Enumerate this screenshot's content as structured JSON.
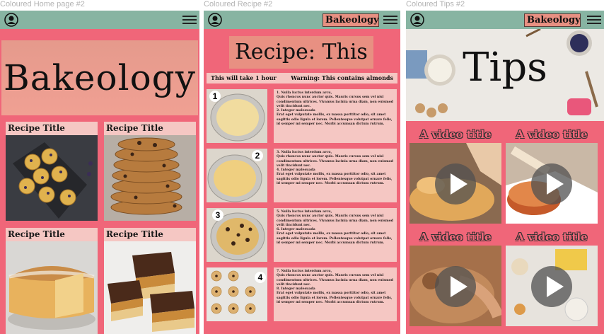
{
  "frames": {
    "home_label": "Coloured Home page #2",
    "recipe_label": "Coloured Recipe #2",
    "tips_label": "Coloured Tips #2"
  },
  "brand": "Bakeology",
  "home": {
    "hero_title": "Bakeology",
    "cards": [
      {
        "title": "Recipe Title",
        "image": "blueberry-muffins"
      },
      {
        "title": "Recipe Title",
        "image": "chocolate-chip-cookies"
      },
      {
        "title": "Recipe Title",
        "image": "sponge-cake"
      },
      {
        "title": "Recipe Title",
        "image": "caramel-shortbread"
      }
    ]
  },
  "recipe": {
    "title": "Recipe: This",
    "time": "This will take 1 hour",
    "warning": "Warning: This contains almonds",
    "steps": [
      {
        "num": "1",
        "a_title": "1. Nulla luctus interdum arcu,",
        "a_body": "Quis rhoncus nunc auctor quis. Mauris cursus sem vel nisl condimentum ultrices. Vivamus lacinia urna diam, non euismod velit tincidunt nec.",
        "b_title": "2. Integer malesuada",
        "b_body": "Erat eget vulputate mollis, ex massa porttitor odio, sit amet sagittis odio ligula et lorem. Pellentesque volutpat ornare felis, id semper mi semper nec. Morbi accumsan dictum rutrum."
      },
      {
        "num": "2",
        "a_title": "3. Nulla luctus interdum arcu,",
        "a_body": "Quis rhoncus nunc auctor quis. Mauris cursus sem vel nisl condimentum ultrices. Vivamus lacinia urna diam, non euismod velit tincidunt nec.",
        "b_title": "4. Integer malesuada",
        "b_body": "Erat eget vulputate mollis, ex massa porttitor odio, sit amet sagittis odio ligula et lorem. Pellentesque volutpat ornare felis, id semper mi semper nec. Morbi accumsan dictum rutrum."
      },
      {
        "num": "3",
        "a_title": "5. Nulla luctus interdum arcu,",
        "a_body": "Quis rhoncus nunc auctor quis. Mauris cursus sem vel nisl condimentum ultrices. Vivamus lacinia urna diam, non euismod velit tincidunt nec.",
        "b_title": "6. Integer malesuada",
        "b_body": "Erat eget vulputate mollis, ex massa porttitor odio, sit amet sagittis odio ligula et lorem. Pellentesque volutpat ornare felis, id semper mi semper nec. Morbi accumsan dictum rutrum."
      },
      {
        "num": "4",
        "a_title": "7. Nulla luctus interdum arcu,",
        "a_body": "Quis rhoncus nunc auctor quis. Mauris cursus sem vel nisl condimentum ultrices. Vivamus lacinia urna diam, non euismod velit tincidunt nec.",
        "b_title": "8. Integer malesuada",
        "b_body": "Erat eget vulputate mollis, ex massa porttitor odio, sit amet sagittis odio ligula et lorem. Pellentesque volutpat ornare felis, id semper mi semper nec. Morbi accumsan dictum rutrum."
      }
    ]
  },
  "tips": {
    "hero_title": "Tips",
    "videos": [
      {
        "title": "A video title",
        "image": "pastry-brushing"
      },
      {
        "title": "A video title",
        "image": "cake-filling"
      },
      {
        "title": "A video title",
        "image": "dough-rolling"
      },
      {
        "title": "A video title",
        "image": "baking-ingredients"
      }
    ]
  },
  "icons": {
    "avatar": "user-circle-icon",
    "menu": "hamburger-menu-icon",
    "play": "play-icon"
  },
  "colors": {
    "page_bg": "#f06679",
    "topbar": "#87b4a2",
    "card": "#f5c7c3",
    "accent": "#e89082"
  }
}
